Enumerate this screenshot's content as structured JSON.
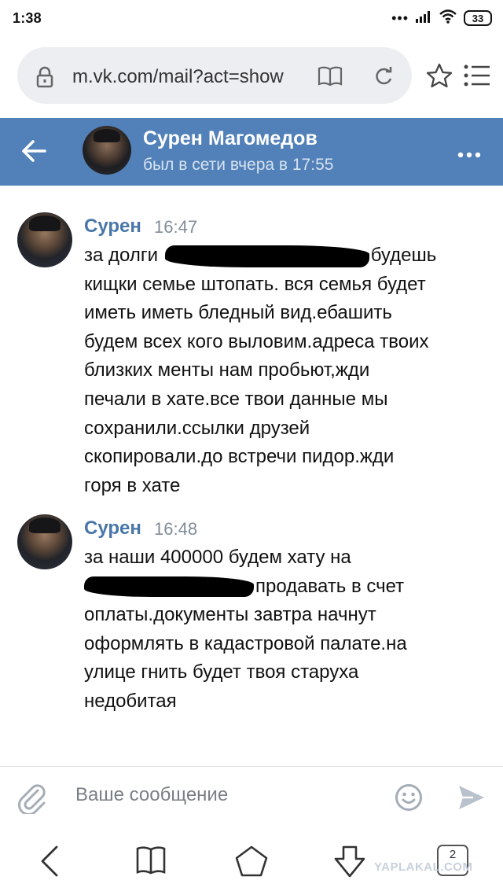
{
  "status_bar": {
    "time": "1:38",
    "signal_dots": "•••",
    "battery": "33"
  },
  "browser": {
    "url": "m.vk.com/mail?act=show",
    "icons": [
      "lock-icon",
      "book-icon",
      "reload-icon",
      "star-icon",
      "menu-icon"
    ]
  },
  "chat_header": {
    "name": "Сурен Магомедов",
    "status": "был в сети вчера в 17:55"
  },
  "messages": [
    {
      "author": "Сурен",
      "time": "16:47",
      "lines": [
        {
          "before": "за долги ",
          "after": "будешь"
        },
        {
          "text": "кищки семье штопать. вся семья будет"
        },
        {
          "text": "иметь иметь бледный вид.ебашить"
        },
        {
          "text": "будем всех кого выловим.адреса твоих"
        },
        {
          "text": "близких менты нам пробьют,жди"
        },
        {
          "text": "печали в хате.все твои данные мы"
        },
        {
          "text": "сохранили.ссылки друзей"
        },
        {
          "text": "скопировали.до встречи пидор.жди"
        },
        {
          "text": "горя в хате"
        }
      ]
    },
    {
      "author": "Сурен",
      "time": "16:48",
      "lines": [
        {
          "text": "за наши 400000 будем хату на"
        },
        {
          "before": "",
          "after": "продавать в счет"
        },
        {
          "text": "оплаты.документы завтра начнут"
        },
        {
          "text": "оформлять в кадастровой палате.на"
        },
        {
          "text": "улице гнить будет твоя старуха"
        },
        {
          "text": "недобитая"
        }
      ]
    }
  ],
  "composer": {
    "placeholder": "Ваше сообщение"
  },
  "nav_bar": {
    "tab_count": "2"
  },
  "watermark": "YAPLAKAL.COM",
  "colors": {
    "vk_header": "#5181b8",
    "author_name": "#4a76a8",
    "time": "#818c99"
  }
}
